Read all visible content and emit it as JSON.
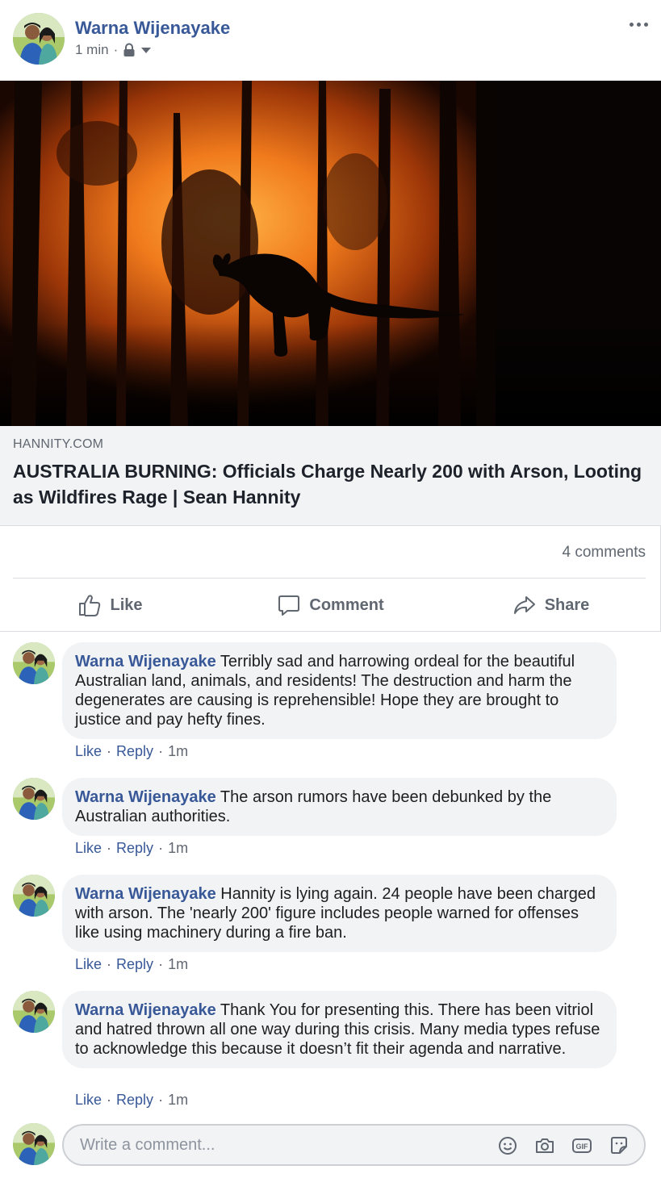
{
  "post": {
    "author": "Warna Wijenayake",
    "time": "1 min",
    "separator": "·"
  },
  "link": {
    "domain": "HANNITY.COM",
    "title": "AUSTRALIA BURNING: Officials Charge Nearly 200 with Arson, Looting as Wildfires Rage | Sean Hannity"
  },
  "stats": {
    "comments": "4 comments"
  },
  "actions": {
    "like": "Like",
    "comment": "Comment",
    "share": "Share"
  },
  "comments": [
    {
      "author": "Warna Wijenayake",
      "text": "Terribly sad and harrowing ordeal for the beautiful Australian land, animals, and residents! The destruction and harm the degenerates are causing is reprehensible! Hope they are brought to justice and pay hefty fines.",
      "like": "Like",
      "reply": "Reply",
      "time": "1m",
      "sep": "·"
    },
    {
      "author": "Warna Wijenayake",
      "text": "The arson rumors have been debunked by the Australian authorities.",
      "like": "Like",
      "reply": "Reply",
      "time": "1m",
      "sep": "·"
    },
    {
      "author": "Warna Wijenayake",
      "text": "Hannity is lying again. 24 people have been charged with arson. The 'nearly 200' figure includes people warned for offenses like using machinery during a fire ban.",
      "like": "Like",
      "reply": "Reply",
      "time": "1m",
      "sep": "·"
    },
    {
      "author": "Warna Wijenayake",
      "text": "Thank You for presenting this. There has been vitriol and hatred thrown all one way during this crisis. Many media types refuse to acknowledge this because it doesn’t fit their agenda and narrative.",
      "like": "Like",
      "reply": "Reply",
      "time": "1m",
      "sep": "·"
    }
  ],
  "composer": {
    "placeholder": "Write a comment..."
  },
  "icons": {
    "privacy": "lock-icon",
    "audience_menu": "caret-down-icon",
    "more": "more-options-icon",
    "like": "thumbs-up-icon",
    "comment": "speech-bubble-icon",
    "share": "share-arrow-icon",
    "emoji": "emoji-icon",
    "camera": "camera-icon",
    "gif": "gif-icon",
    "sticker": "sticker-icon"
  },
  "colors": {
    "name_blue": "#385898",
    "meta_gray": "#606770",
    "bubble_bg": "#f2f3f5",
    "fire_orange": "#e8731a"
  }
}
